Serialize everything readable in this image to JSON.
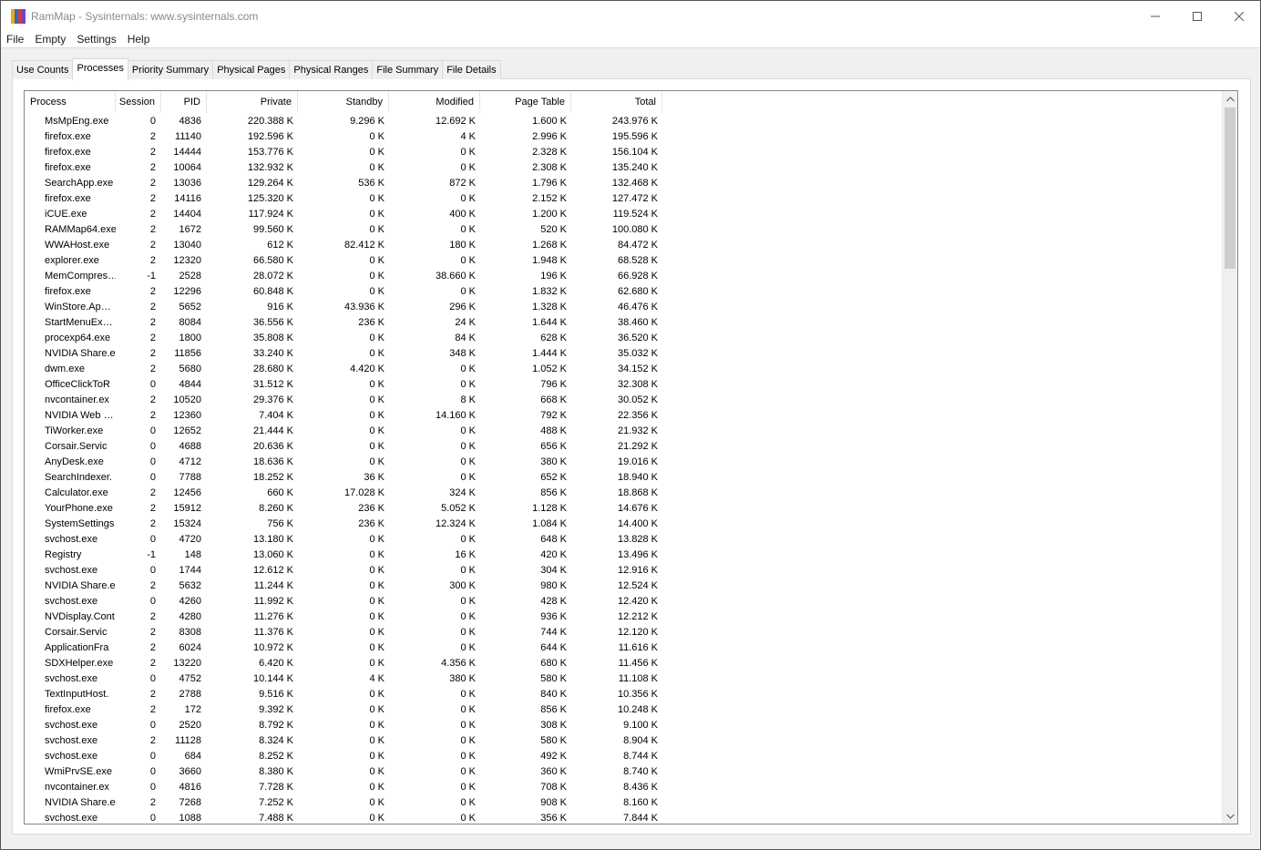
{
  "window": {
    "title": "RamMap - Sysinternals: www.sysinternals.com",
    "icon_colors": [
      "#f2a900",
      "#1f6fd0",
      "#d83b3b",
      "#7b3fbf"
    ],
    "minimize_icon": "minimize-icon",
    "maximize_icon": "maximize-icon",
    "close_icon": "close-icon"
  },
  "menu": [
    "File",
    "Empty",
    "Settings",
    "Help"
  ],
  "tabs": [
    "Use Counts",
    "Processes",
    "Priority Summary",
    "Physical Pages",
    "Physical Ranges",
    "File Summary",
    "File Details"
  ],
  "active_tab": "Processes",
  "columns": {
    "process": "Process",
    "session": "Session",
    "pid": "PID",
    "private": "Private",
    "standby": "Standby",
    "modified": "Modified",
    "page_table": "Page Table",
    "total": "Total",
    "sort_indicator": "ˇ"
  },
  "rows": [
    [
      "MsMpEng.exe",
      "0",
      "4836",
      "220.388 K",
      "9.296 K",
      "12.692 K",
      "1.600 K",
      "243.976 K"
    ],
    [
      "firefox.exe",
      "2",
      "11140",
      "192.596 K",
      "0 K",
      "4 K",
      "2.996 K",
      "195.596 K"
    ],
    [
      "firefox.exe",
      "2",
      "14444",
      "153.776 K",
      "0 K",
      "0 K",
      "2.328 K",
      "156.104 K"
    ],
    [
      "firefox.exe",
      "2",
      "10064",
      "132.932 K",
      "0 K",
      "0 K",
      "2.308 K",
      "135.240 K"
    ],
    [
      "SearchApp.exe",
      "2",
      "13036",
      "129.264 K",
      "536 K",
      "872 K",
      "1.796 K",
      "132.468 K"
    ],
    [
      "firefox.exe",
      "2",
      "14116",
      "125.320 K",
      "0 K",
      "0 K",
      "2.152 K",
      "127.472 K"
    ],
    [
      "iCUE.exe",
      "2",
      "14404",
      "117.924 K",
      "0 K",
      "400 K",
      "1.200 K",
      "119.524 K"
    ],
    [
      "RAMMap64.exe",
      "2",
      "1672",
      "99.560 K",
      "0 K",
      "0 K",
      "520 K",
      "100.080 K"
    ],
    [
      "WWAHost.exe",
      "2",
      "13040",
      "612 K",
      "82.412 K",
      "180 K",
      "1.268 K",
      "84.472 K"
    ],
    [
      "explorer.exe",
      "2",
      "12320",
      "66.580 K",
      "0 K",
      "0 K",
      "1.948 K",
      "68.528 K"
    ],
    [
      "MemCompres…",
      "-1",
      "2528",
      "28.072 K",
      "0 K",
      "38.660 K",
      "196 K",
      "66.928 K"
    ],
    [
      "firefox.exe",
      "2",
      "12296",
      "60.848 K",
      "0 K",
      "0 K",
      "1.832 K",
      "62.680 K"
    ],
    [
      "WinStore.Ap…",
      "2",
      "5652",
      "916 K",
      "43.936 K",
      "296 K",
      "1.328 K",
      "46.476 K"
    ],
    [
      "StartMenuEx…",
      "2",
      "8084",
      "36.556 K",
      "236 K",
      "24 K",
      "1.644 K",
      "38.460 K"
    ],
    [
      "procexp64.exe",
      "2",
      "1800",
      "35.808 K",
      "0 K",
      "84 K",
      "628 K",
      "36.520 K"
    ],
    [
      "NVIDIA Share.e",
      "2",
      "11856",
      "33.240 K",
      "0 K",
      "348 K",
      "1.444 K",
      "35.032 K"
    ],
    [
      "dwm.exe",
      "2",
      "5680",
      "28.680 K",
      "4.420 K",
      "0 K",
      "1.052 K",
      "34.152 K"
    ],
    [
      "OfficeClickToR",
      "0",
      "4844",
      "31.512 K",
      "0 K",
      "0 K",
      "796 K",
      "32.308 K"
    ],
    [
      "nvcontainer.ex",
      "2",
      "10520",
      "29.376 K",
      "0 K",
      "8 K",
      "668 K",
      "30.052 K"
    ],
    [
      "NVIDIA Web …",
      "2",
      "12360",
      "7.404 K",
      "0 K",
      "14.160 K",
      "792 K",
      "22.356 K"
    ],
    [
      "TiWorker.exe",
      "0",
      "12652",
      "21.444 K",
      "0 K",
      "0 K",
      "488 K",
      "21.932 K"
    ],
    [
      "Corsair.Servic",
      "0",
      "4688",
      "20.636 K",
      "0 K",
      "0 K",
      "656 K",
      "21.292 K"
    ],
    [
      "AnyDesk.exe",
      "0",
      "4712",
      "18.636 K",
      "0 K",
      "0 K",
      "380 K",
      "19.016 K"
    ],
    [
      "SearchIndexer.",
      "0",
      "7788",
      "18.252 K",
      "36 K",
      "0 K",
      "652 K",
      "18.940 K"
    ],
    [
      "Calculator.exe",
      "2",
      "12456",
      "660 K",
      "17.028 K",
      "324 K",
      "856 K",
      "18.868 K"
    ],
    [
      "YourPhone.exe",
      "2",
      "15912",
      "8.260 K",
      "236 K",
      "5.052 K",
      "1.128 K",
      "14.676 K"
    ],
    [
      "SystemSettings",
      "2",
      "15324",
      "756 K",
      "236 K",
      "12.324 K",
      "1.084 K",
      "14.400 K"
    ],
    [
      "svchost.exe",
      "0",
      "4720",
      "13.180 K",
      "0 K",
      "0 K",
      "648 K",
      "13.828 K"
    ],
    [
      "Registry",
      "-1",
      "148",
      "13.060 K",
      "0 K",
      "16 K",
      "420 K",
      "13.496 K"
    ],
    [
      "svchost.exe",
      "0",
      "1744",
      "12.612 K",
      "0 K",
      "0 K",
      "304 K",
      "12.916 K"
    ],
    [
      "NVIDIA Share.e",
      "2",
      "5632",
      "11.244 K",
      "0 K",
      "300 K",
      "980 K",
      "12.524 K"
    ],
    [
      "svchost.exe",
      "0",
      "4260",
      "11.992 K",
      "0 K",
      "0 K",
      "428 K",
      "12.420 K"
    ],
    [
      "NVDisplay.Cont",
      "2",
      "4280",
      "11.276 K",
      "0 K",
      "0 K",
      "936 K",
      "12.212 K"
    ],
    [
      "Corsair.Servic",
      "2",
      "8308",
      "11.376 K",
      "0 K",
      "0 K",
      "744 K",
      "12.120 K"
    ],
    [
      "ApplicationFra",
      "2",
      "6024",
      "10.972 K",
      "0 K",
      "0 K",
      "644 K",
      "11.616 K"
    ],
    [
      "SDXHelper.exe",
      "2",
      "13220",
      "6.420 K",
      "0 K",
      "4.356 K",
      "680 K",
      "11.456 K"
    ],
    [
      "svchost.exe",
      "0",
      "4752",
      "10.144 K",
      "4 K",
      "380 K",
      "580 K",
      "11.108 K"
    ],
    [
      "TextInputHost.",
      "2",
      "2788",
      "9.516 K",
      "0 K",
      "0 K",
      "840 K",
      "10.356 K"
    ],
    [
      "firefox.exe",
      "2",
      "172",
      "9.392 K",
      "0 K",
      "0 K",
      "856 K",
      "10.248 K"
    ],
    [
      "svchost.exe",
      "0",
      "2520",
      "8.792 K",
      "0 K",
      "0 K",
      "308 K",
      "9.100 K"
    ],
    [
      "svchost.exe",
      "2",
      "11128",
      "8.324 K",
      "0 K",
      "0 K",
      "580 K",
      "8.904 K"
    ],
    [
      "svchost.exe",
      "0",
      "684",
      "8.252 K",
      "0 K",
      "0 K",
      "492 K",
      "8.744 K"
    ],
    [
      "WmiPrvSE.exe",
      "0",
      "3660",
      "8.380 K",
      "0 K",
      "0 K",
      "360 K",
      "8.740 K"
    ],
    [
      "nvcontainer.ex",
      "0",
      "4816",
      "7.728 K",
      "0 K",
      "0 K",
      "708 K",
      "8.436 K"
    ],
    [
      "NVIDIA Share.e",
      "2",
      "7268",
      "7.252 K",
      "0 K",
      "0 K",
      "908 K",
      "8.160 K"
    ],
    [
      "svchost.exe",
      "0",
      "1088",
      "7.488 K",
      "0 K",
      "0 K",
      "356 K",
      "7.844 K"
    ]
  ]
}
